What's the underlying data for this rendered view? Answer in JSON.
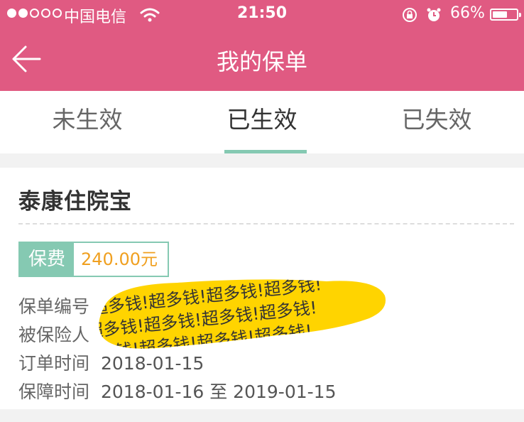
{
  "status_bar": {
    "carrier": "中国电信",
    "time": "21:50",
    "battery": "66%",
    "battery_level": 0.66
  },
  "nav": {
    "title": "我的保单",
    "back_icon": "arrow-left-icon"
  },
  "tabs": [
    {
      "label": "未生效",
      "active": false
    },
    {
      "label": "已生效",
      "active": true
    },
    {
      "label": "已失效",
      "active": false
    }
  ],
  "policy": {
    "product_name": "泰康住院宝",
    "premium_label": "保费",
    "premium_value": "240.00元",
    "fields": [
      {
        "label": "保单编号",
        "value": ""
      },
      {
        "label": "被保险人",
        "value": ""
      },
      {
        "label": "订单时间",
        "value": "2018-01-15"
      },
      {
        "label": "保障时间",
        "value": "2018-01-16 至 2019-01-15"
      }
    ],
    "redaction_text": "超多钱!超多钱!超多钱!超多钱!"
  },
  "colors": {
    "header": "#e05a82",
    "accent": "#85c9b2",
    "premium_value": "#f0a020",
    "redaction": "#ffd400"
  }
}
